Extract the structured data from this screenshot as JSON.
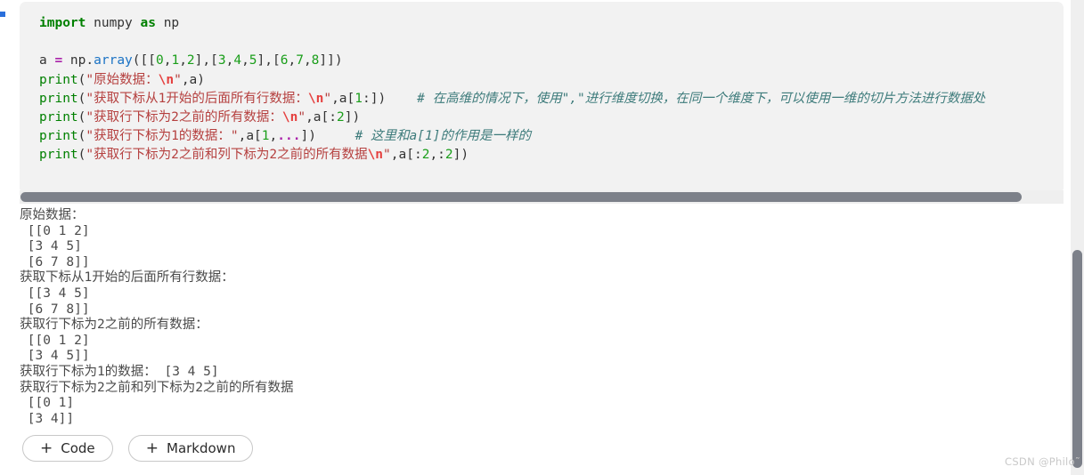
{
  "cell_marker": {
    "color": "#2a6fdb"
  },
  "code_cell": {
    "background": "#f2f2f2",
    "lines": [
      {
        "id": "line-1",
        "tokens": [
          {
            "t": "import",
            "c": "kw"
          },
          {
            "t": " numpy ",
            "c": "plain"
          },
          {
            "t": "as",
            "c": "kw"
          },
          {
            "t": " np",
            "c": "plain"
          }
        ]
      },
      {
        "id": "line-2",
        "tokens": []
      },
      {
        "id": "line-3",
        "tokens": [
          {
            "t": "a ",
            "c": "plain"
          },
          {
            "t": "=",
            "c": "op"
          },
          {
            "t": " np.",
            "c": "plain"
          },
          {
            "t": "array",
            "c": "bltn"
          },
          {
            "t": "([[",
            "c": "plain"
          },
          {
            "t": "0",
            "c": "num"
          },
          {
            "t": ",",
            "c": "plain"
          },
          {
            "t": "1",
            "c": "num"
          },
          {
            "t": ",",
            "c": "plain"
          },
          {
            "t": "2",
            "c": "num"
          },
          {
            "t": "],[",
            "c": "plain"
          },
          {
            "t": "3",
            "c": "num"
          },
          {
            "t": ",",
            "c": "plain"
          },
          {
            "t": "4",
            "c": "num"
          },
          {
            "t": ",",
            "c": "plain"
          },
          {
            "t": "5",
            "c": "num"
          },
          {
            "t": "],[",
            "c": "plain"
          },
          {
            "t": "6",
            "c": "num"
          },
          {
            "t": ",",
            "c": "plain"
          },
          {
            "t": "7",
            "c": "num"
          },
          {
            "t": ",",
            "c": "plain"
          },
          {
            "t": "8",
            "c": "num"
          },
          {
            "t": "]])",
            "c": "plain"
          }
        ]
      },
      {
        "id": "line-4",
        "tokens": [
          {
            "t": "print",
            "c": "fn"
          },
          {
            "t": "(",
            "c": "plain"
          },
          {
            "t": "\"原始数据：",
            "c": "str"
          },
          {
            "t": "\\n",
            "c": "esc"
          },
          {
            "t": "\"",
            "c": "str"
          },
          {
            "t": ",a)",
            "c": "plain"
          }
        ]
      },
      {
        "id": "line-5",
        "tokens": [
          {
            "t": "print",
            "c": "fn"
          },
          {
            "t": "(",
            "c": "plain"
          },
          {
            "t": "\"获取下标从1开始的后面所有行数据：",
            "c": "str"
          },
          {
            "t": "\\n",
            "c": "esc"
          },
          {
            "t": "\"",
            "c": "str"
          },
          {
            "t": ",a[",
            "c": "plain"
          },
          {
            "t": "1",
            "c": "num"
          },
          {
            "t": ":])",
            "c": "plain"
          },
          {
            "t": "    ",
            "c": "plain"
          },
          {
            "t": "# 在高维的情况下，使用\",\"进行维度切换，在同一个维度下，可以使用一维的切片方法进行数据处",
            "c": "cmt"
          }
        ]
      },
      {
        "id": "line-6",
        "tokens": [
          {
            "t": "print",
            "c": "fn"
          },
          {
            "t": "(",
            "c": "plain"
          },
          {
            "t": "\"获取行下标为2之前的所有数据：",
            "c": "str"
          },
          {
            "t": "\\n",
            "c": "esc"
          },
          {
            "t": "\"",
            "c": "str"
          },
          {
            "t": ",a[:",
            "c": "plain"
          },
          {
            "t": "2",
            "c": "num"
          },
          {
            "t": "])",
            "c": "plain"
          }
        ]
      },
      {
        "id": "line-7",
        "tokens": [
          {
            "t": "print",
            "c": "fn"
          },
          {
            "t": "(",
            "c": "plain"
          },
          {
            "t": "\"获取行下标为1的数据：\"",
            "c": "str"
          },
          {
            "t": ",a[",
            "c": "plain"
          },
          {
            "t": "1",
            "c": "num"
          },
          {
            "t": ",",
            "c": "plain"
          },
          {
            "t": "...",
            "c": "ell"
          },
          {
            "t": "])",
            "c": "plain"
          },
          {
            "t": "     ",
            "c": "plain"
          },
          {
            "t": "# 这里和a[1]的作用是一样的",
            "c": "cmt"
          }
        ]
      },
      {
        "id": "line-8",
        "tokens": [
          {
            "t": "print",
            "c": "fn"
          },
          {
            "t": "(",
            "c": "plain"
          },
          {
            "t": "\"获取行下标为2之前和列下标为2之前的所有数据",
            "c": "str"
          },
          {
            "t": "\\n",
            "c": "esc"
          },
          {
            "t": "\"",
            "c": "str"
          },
          {
            "t": ",a[:",
            "c": "plain"
          },
          {
            "t": "2",
            "c": "num"
          },
          {
            "t": ",:",
            "c": "plain"
          },
          {
            "t": "2",
            "c": "num"
          },
          {
            "t": "])",
            "c": "plain"
          }
        ]
      }
    ]
  },
  "output": {
    "lines": [
      "原始数据：",
      " [[0 1 2]",
      " [3 4 5]",
      " [6 7 8]]",
      "获取下标从1开始的后面所有行数据：",
      " [[3 4 5]",
      " [6 7 8]]",
      "获取行下标为2之前的所有数据：",
      " [[0 1 2]",
      " [3 4 5]]",
      "获取行下标为1的数据： [3 4 5]",
      "获取行下标为2之前和列下标为2之前的所有数据",
      " [[0 1]",
      " [3 4]]"
    ]
  },
  "buttons": {
    "plus_glyph": "+",
    "code_label": "Code",
    "markdown_label": "Markdown"
  },
  "watermark": {
    "text": "CSDN @Philo˜"
  }
}
